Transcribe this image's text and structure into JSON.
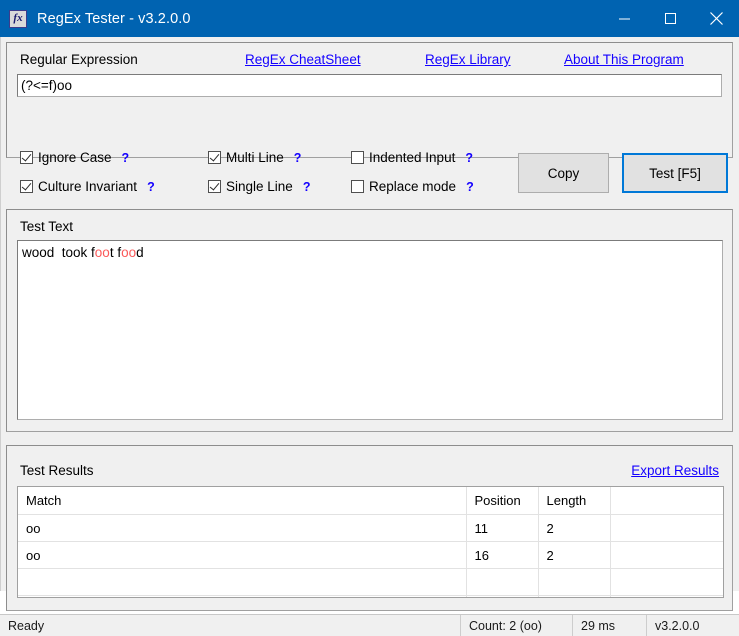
{
  "window": {
    "title": "RegEx Tester - v3.2.0.0",
    "icon": "app-fx-icon",
    "icon_glyph": "fx",
    "accent_color": "#0063b1",
    "controls": {
      "minimize": "minimize-icon",
      "maximize": "maximize-icon",
      "close": "close-icon"
    }
  },
  "regex_section": {
    "label": "Regular Expression",
    "links": [
      {
        "name": "regex-cheatsheet-link",
        "label": "RegEx CheatSheet"
      },
      {
        "name": "regex-library-link",
        "label": "RegEx Library"
      },
      {
        "name": "about-this-program-link",
        "label": "About This Program"
      }
    ],
    "input": {
      "value": "(?<=f)oo",
      "placeholder": ""
    },
    "link_color": "#1400ff"
  },
  "options": [
    {
      "name": "ignore-case",
      "label": "Ignore Case",
      "checked": true,
      "help": "?"
    },
    {
      "name": "culture-invariant",
      "label": "Culture Invariant",
      "checked": true,
      "help": "?"
    },
    {
      "name": "multi-line",
      "label": "Multi Line",
      "checked": true,
      "help": "?"
    },
    {
      "name": "single-line",
      "label": "Single Line",
      "checked": true,
      "help": "?"
    },
    {
      "name": "indented-input",
      "label": "Indented Input",
      "checked": false,
      "help": "?"
    },
    {
      "name": "replace-mode",
      "label": "Replace mode",
      "checked": false,
      "help": "?"
    }
  ],
  "buttons": {
    "copy": "Copy",
    "test": "Test [F5]",
    "test_focus_color": "#0078d7"
  },
  "test_text_section": {
    "label": "Test Text",
    "segments": [
      {
        "text": "wood  took f",
        "match": false
      },
      {
        "text": "oo",
        "match": true
      },
      {
        "text": "t f",
        "match": false
      },
      {
        "text": "oo",
        "match": true
      },
      {
        "text": "d",
        "match": false
      }
    ],
    "highlight_color": "#fb5a5a"
  },
  "results_section": {
    "label": "Test Results",
    "export_link": "Export Results",
    "columns": [
      "Match",
      "Position",
      "Length",
      ""
    ],
    "rows": [
      [
        "oo",
        "11",
        "2",
        ""
      ],
      [
        "oo",
        "16",
        "2",
        ""
      ],
      [
        "",
        "",
        "",
        ""
      ],
      [
        "",
        "",
        "",
        ""
      ]
    ]
  },
  "statusbar": {
    "message": "Ready",
    "count": "Count: 2 (oo)",
    "time": "29 ms",
    "version": "v3.2.0.0"
  }
}
